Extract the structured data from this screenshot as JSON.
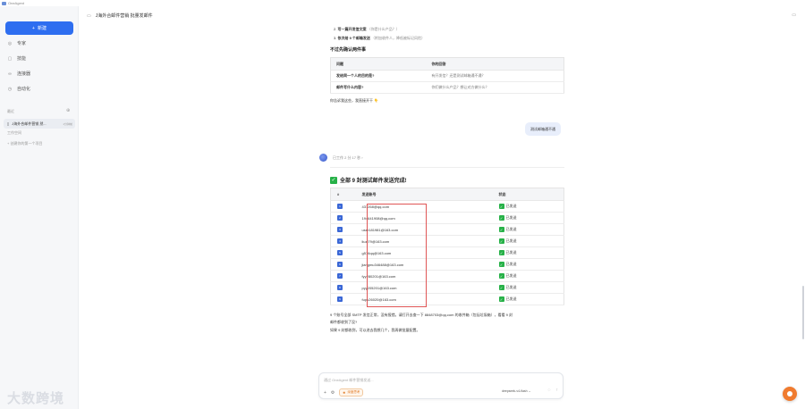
{
  "titlebar": {
    "app_title": "OneAgent",
    "controls": [
      "–",
      "☐",
      "×"
    ]
  },
  "sidebar": {
    "new_chat_label": "新建",
    "nav": [
      {
        "icon": "expert-icon",
        "label": "专家"
      },
      {
        "icon": "skill-icon",
        "label": "技能"
      },
      {
        "icon": "connector-icon",
        "label": "连接器"
      },
      {
        "icon": "automation-icon",
        "label": "自动化"
      }
    ],
    "section_label": "最近",
    "conversation": {
      "label": "J海外合邮件营销 然...",
      "time": "1分钟前"
    },
    "workspace_label": "工作空间",
    "create_hint": "+ 创建你的第一个项目",
    "watermark": "大数跨境"
  },
  "header": {
    "breadcrumb": "J海外合邮件营销 批量发邮件"
  },
  "chat": {
    "list_items": [
      {
        "num": "2.",
        "bold": "写一篇开发信文案",
        "gray": "（你是什么产品？）"
      },
      {
        "num": "3.",
        "bold": "依次给 9 个邮箱发送",
        "gray": "（附加收件人，降低被标记风险）"
      }
    ],
    "confirm_heading": "不过先确认两件事",
    "qa_table": {
      "headers": [
        "问题",
        "你的回答"
      ],
      "rows": [
        {
          "q": "发给同一个人的目的是?",
          "a": "有开发信？还是测试邮箱通不通？"
        },
        {
          "q": "邮件写什么内容?",
          "a": "你们做什么产品？想让对方做什么？"
        }
      ]
    },
    "closing": "你告诉我这些，我直接开干 👇",
    "user_message": "测试邮箱通不通",
    "assistant_meta": "已工作 2 分 17 秒  ›",
    "result_heading": "全部 9 封测试邮件发送完成!",
    "mail_table": {
      "headers": [
        "#",
        "发送账号",
        "状态"
      ],
      "rows": [
        {
          "n": "1",
          "account": "431268@qq.com",
          "status": "已发送"
        },
        {
          "n": "2",
          "account": "194641908@qq.com",
          "status": "已发送"
        },
        {
          "n": "3",
          "account": "user181981@163.com",
          "status": "已发送"
        },
        {
          "n": "4",
          "account": "liuzi79@163.com",
          "status": "已发送"
        },
        {
          "n": "5",
          "account": "g576qq@163.com",
          "status": "已发送"
        },
        {
          "n": "6",
          "account": "jiangmu346488@163.com",
          "status": "已发送"
        },
        {
          "n": "7",
          "account": "fyy280201@163.com",
          "status": "已发送"
        },
        {
          "n": "8",
          "account": "pyy205201@163.com",
          "status": "已发送"
        },
        {
          "n": "9",
          "account": "fupu26020@163.com",
          "status": "已发送"
        }
      ]
    },
    "summary_1": "9 个账号全部 SMTP 发信正常，没有报错。请打开去查一下 8848703@qq.com 的收件箱（包括垃圾箱），看看 9 封",
    "summary_2": "邮件都收到了没?",
    "summary_3": "如果 9 封都收到，可以进去我想几个，我再做批量配置。"
  },
  "composer": {
    "placeholder": "通过 OneAgent 邮件营销发送...",
    "think_label": "深度思考",
    "model": "deepseek-v4-flash ⌄"
  },
  "colors": {
    "accent": "#2e6ef0",
    "success": "#27b148",
    "highlight_box": "#e05656",
    "float_button": "#f07b2f"
  }
}
